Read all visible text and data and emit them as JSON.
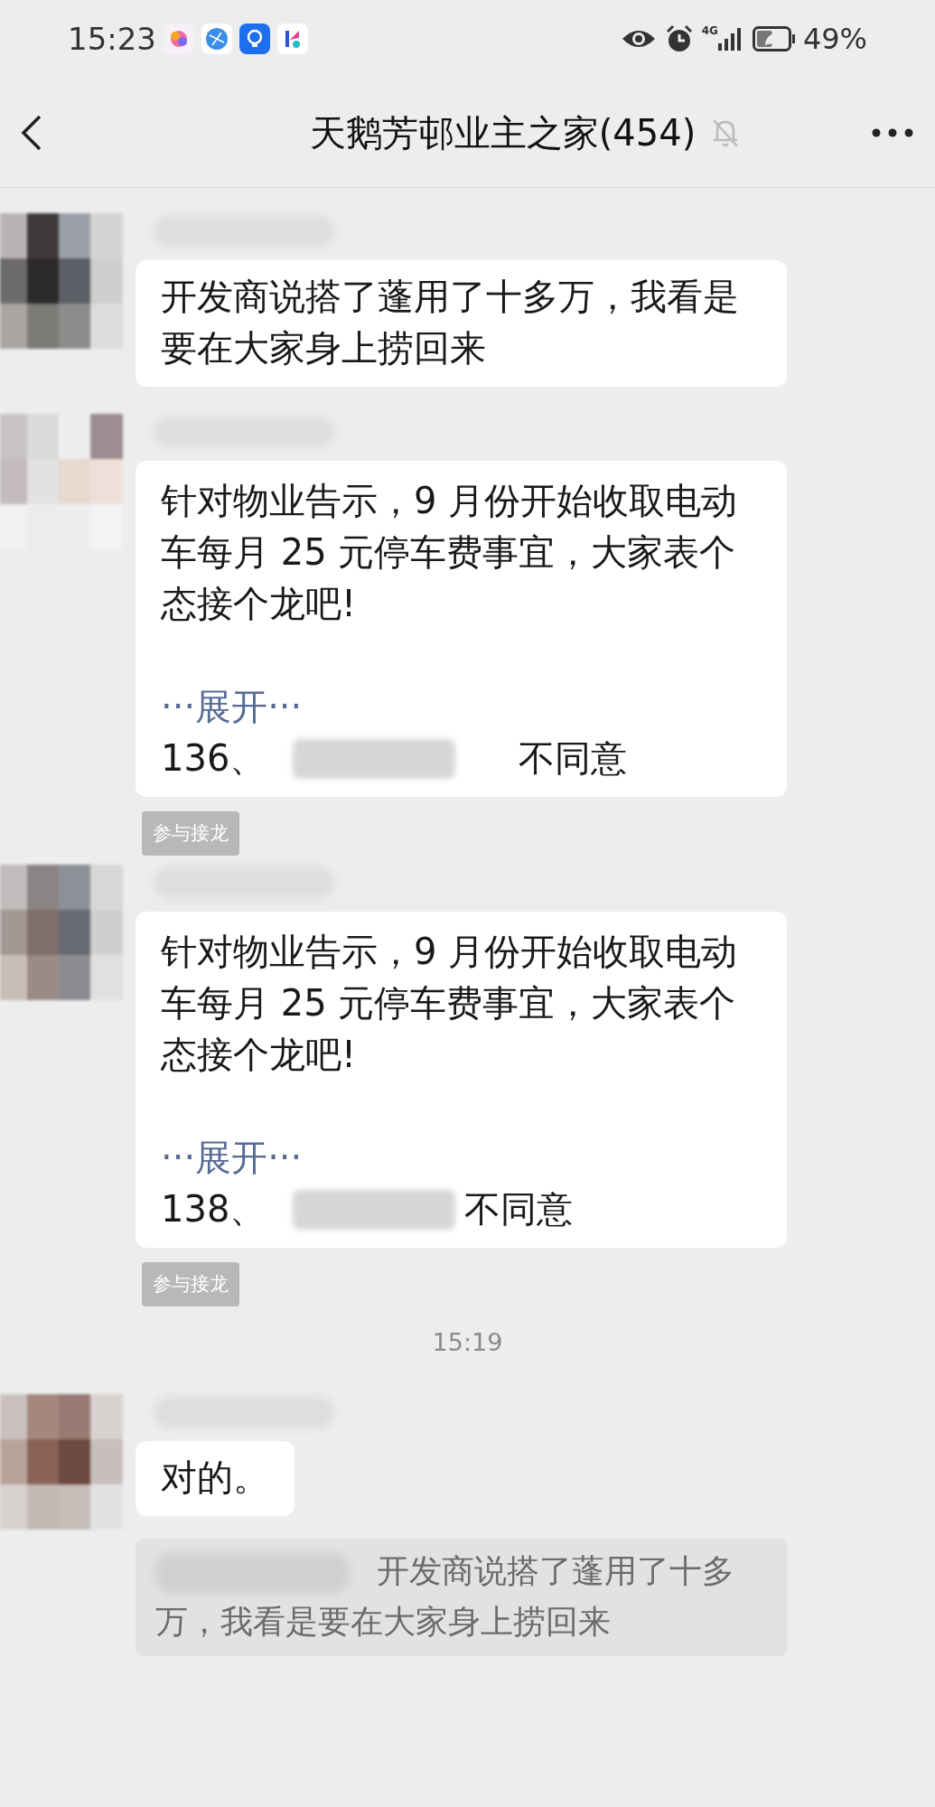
{
  "status_bar": {
    "time": "15:23",
    "network": "4G",
    "battery": "49%"
  },
  "header": {
    "title": "天鹅芳邨业主之家(454)",
    "muted": true
  },
  "messages": [
    {
      "kind": "text",
      "text": "开发商说搭了蓬用了十多万，我看是要在大家身上捞回来"
    },
    {
      "kind": "solitaire",
      "text": "针对物业告示，9 月份开始收取电动车每月 25 元停车费事宜，大家表个态接个龙吧!",
      "expand": "···展开···",
      "entry_number": "136、",
      "entry_text": "不同意",
      "join_label": "参与接龙"
    },
    {
      "kind": "solitaire",
      "text": "针对物业告示，9 月份开始收取电动车每月 25 元停车费事宜，大家表个态接个龙吧!",
      "expand": "···展开···",
      "entry_number": "138、",
      "entry_text": "不同意",
      "join_label": "参与接龙"
    },
    {
      "kind": "time",
      "text": "15:19"
    },
    {
      "kind": "text",
      "text": "对的。",
      "quote": "开发商说搭了蓬用了十多万，我看是要在大家身上捞回来"
    }
  ]
}
